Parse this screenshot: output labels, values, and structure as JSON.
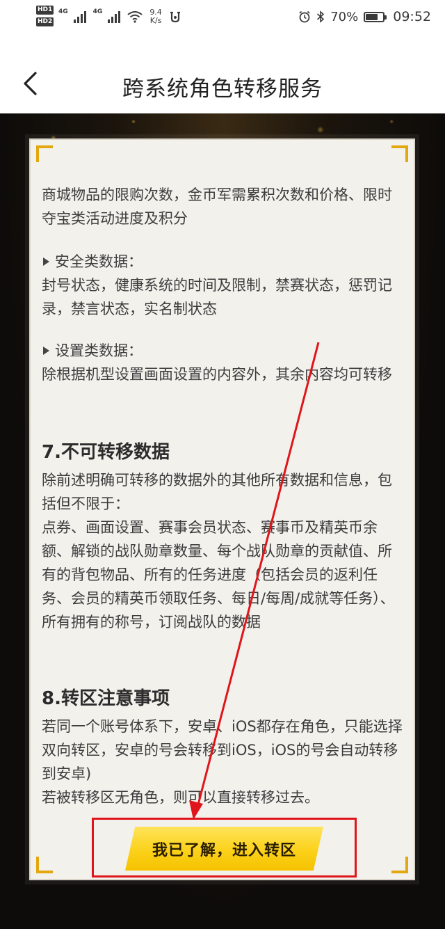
{
  "status_bar": {
    "hd1": "HD1",
    "hd2": "HD2",
    "network1": "4G",
    "network2": "4G",
    "speed_value": "9.4",
    "speed_unit": "K/s",
    "battery": "70%",
    "time": "09:52",
    "icons": [
      "hd-badge-icon",
      "signal-icon",
      "wifi-icon",
      "speed-icon",
      "notification-icon",
      "alarm-icon",
      "bluetooth-icon",
      "battery-icon"
    ]
  },
  "header": {
    "title": "跨系统角色转移服务",
    "back_icon": "chevron-left-icon"
  },
  "content": {
    "para_shop": "商城物品的限购次数，金币军需累积次数和价格、限时夺宝类活动进度及积分",
    "security_head": "安全类数据：",
    "security_body": "封号状态，健康系统的时间及限制，禁赛状态，惩罚记录，禁言状态，实名制状态",
    "settings_head": "设置类数据：",
    "settings_body": "除根据机型设置画面设置的内容外，其余内容均可转移",
    "section7_title": "7.不可转移数据",
    "section7_body_1": "除前述明确可转移的数据外的其他所有数据和信息，包括但不限于：",
    "section7_body_2": "点券、画面设置、赛事会员状态、赛事币及精英币余额、解锁的战队勋章数量、每个战队勋章的贡献值、所有的背包物品、所有的任务进度（包括会员的返利任务、会员的精英币领取任务、每日/每周/成就等任务）、所有拥有的称号，订阅战队的数据",
    "section8_title": "8.转区注意事项",
    "section8_body_1": "若同一个账号体系下，安卓、iOS都存在角色，只能选择双向转区，安卓的号会转移到iOS，iOS的号会自动转移到安卓)",
    "section8_body_2": "若被转移区无角色，则可以直接转移过去。"
  },
  "cta": {
    "label": "我已了解，进入转区"
  },
  "colors": {
    "accent_yellow": "#fbd11a",
    "corner_gold": "#e3a80f",
    "annotation_red": "#e0151b"
  }
}
